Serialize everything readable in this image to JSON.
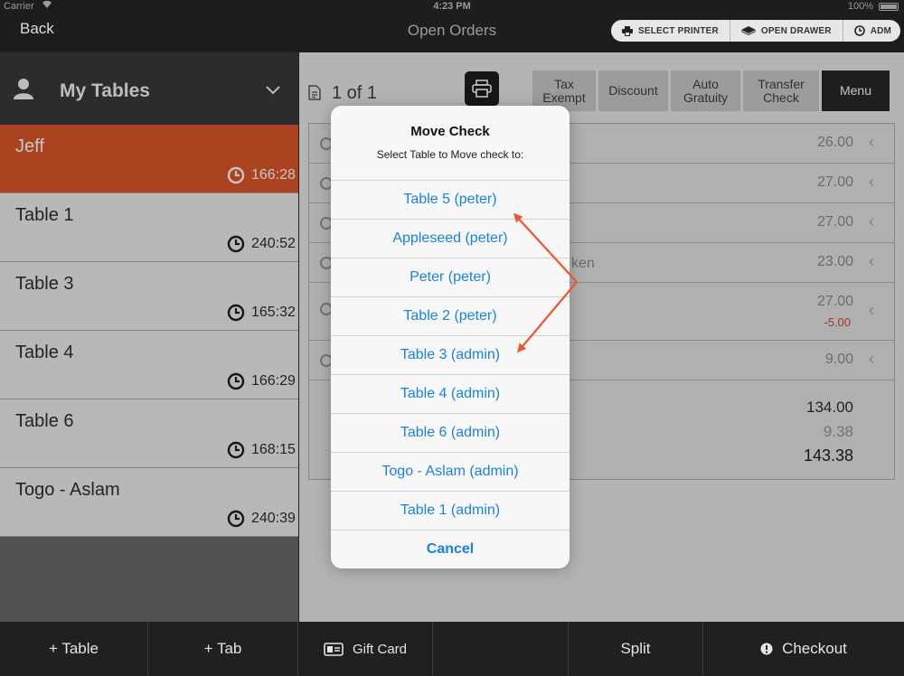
{
  "status": {
    "carrier": "Carrier",
    "time": "4:23 PM",
    "battery": "100%"
  },
  "nav": {
    "back": "Back",
    "title": "Open Orders",
    "select_printer": "SELECT PRINTER",
    "open_drawer": "OPEN DRAWER",
    "user": "ADM"
  },
  "sidebar": {
    "title": "My Tables",
    "tables": [
      {
        "name": "Jeff",
        "time": "166:28",
        "active": true
      },
      {
        "name": "Table 1",
        "time": "240:52"
      },
      {
        "name": "Table 3",
        "time": "165:32"
      },
      {
        "name": "Table 4",
        "time": "166:29"
      },
      {
        "name": "Table 6",
        "time": "168:15"
      },
      {
        "name": "Togo - Aslam",
        "time": "240:39"
      }
    ]
  },
  "check": {
    "page": "1 of 1",
    "tabs": [
      "Tax Exempt",
      "Discount",
      "Auto Gratuity",
      "Transfer Check",
      "Menu"
    ],
    "items": [
      {
        "name": "",
        "price": "26.00"
      },
      {
        "name": "",
        "price": "27.00"
      },
      {
        "name": "",
        "price": "27.00"
      },
      {
        "name": "ken",
        "price": "23.00"
      },
      {
        "name": "",
        "price": "27.00",
        "discount": "-5.00"
      },
      {
        "name": "",
        "price": "9.00"
      }
    ],
    "totals": {
      "subtotal": "134.00",
      "tax": "9.38",
      "total": "143.38"
    }
  },
  "bottom": {
    "add_table": "+ Table",
    "add_tab": "+ Tab",
    "gift_card": "Gift Card",
    "split": "Split",
    "checkout": "Checkout"
  },
  "dialog": {
    "title": "Move Check",
    "subtitle": "Select Table to Move check to:",
    "options": [
      "Table 5 (peter)",
      "Appleseed (peter)",
      "Peter (peter)",
      "Table 2 (peter)",
      "Table 3 (admin)",
      "Table 4 (admin)",
      "Table 6 (admin)",
      "Togo - Aslam (admin)",
      "Table 1 (admin)"
    ],
    "cancel": "Cancel"
  },
  "colors": {
    "accent": "#d04b1f",
    "link": "#1a82e6",
    "annotation": "#ee5533"
  },
  "icons": [
    "wifi-icon",
    "battery-icon",
    "printer-icon",
    "drawer-icon",
    "clock-icon",
    "user-icon",
    "chevron-down-icon",
    "document-icon",
    "gift-card-icon",
    "info-icon"
  ]
}
